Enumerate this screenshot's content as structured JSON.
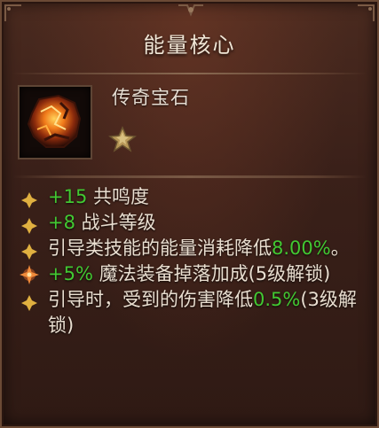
{
  "tooltip": {
    "title": "能量核心",
    "item_type": "传奇宝石",
    "rank_icon": "star-icon",
    "item_icon": "molten-gem-icon",
    "colors": {
      "value_green": "#42c832",
      "bullet_gold": "#e0b040",
      "text": "#e9ded0"
    },
    "attributes": [
      {
        "value": "+15",
        "text": " 共鸣度",
        "after": ""
      },
      {
        "value": "+8",
        "text": " 战斗等级",
        "after": ""
      },
      {
        "value": "8.00%",
        "text": "引导类技能的能量消耗降低",
        "after": "。"
      },
      {
        "value": "+5%",
        "text": " 魔法装备掉落加成(5级解锁)",
        "after": "",
        "legendary": true
      },
      {
        "value": "0.5%",
        "text": "引导时，受到的伤害降低",
        "after": "(3级解锁)"
      }
    ]
  }
}
